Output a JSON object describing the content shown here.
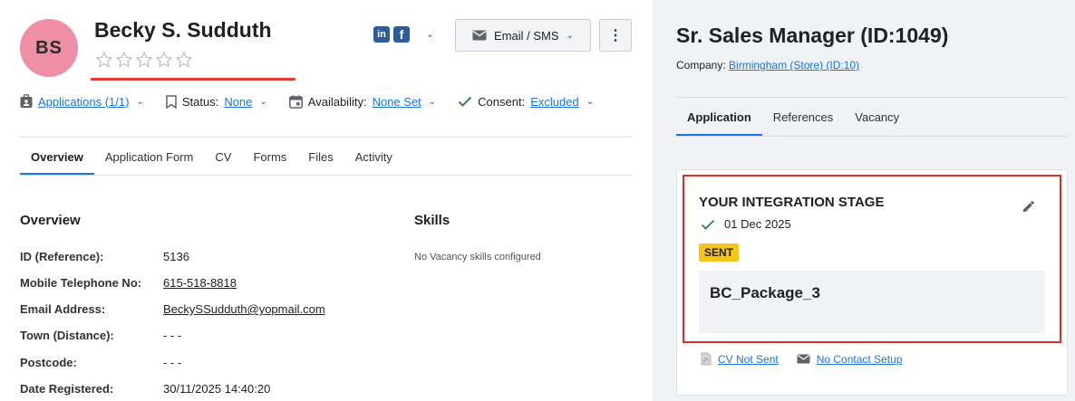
{
  "candidate": {
    "initials": "BS",
    "name": "Becky S. Sudduth",
    "rating_stars": 5,
    "rating_value": 0,
    "avatar_color": "#ee8fa6"
  },
  "actions": {
    "email_sms_label": "Email / SMS",
    "social": [
      "linkedin-icon",
      "facebook-icon"
    ]
  },
  "meta": {
    "applications_label": "Applications (1/1)",
    "status_label": "Status:",
    "status_value": "None",
    "availability_label": "Availability:",
    "availability_value": "None Set",
    "consent_label": "Consent:",
    "consent_value": "Excluded"
  },
  "tabs": [
    "Overview",
    "Application Form",
    "CV",
    "Forms",
    "Files",
    "Activity"
  ],
  "overview": {
    "title": "Overview",
    "fields": [
      {
        "label": "ID (Reference):",
        "value": "5136",
        "link": false
      },
      {
        "label": "Mobile Telephone No:",
        "value": "615-518-8818",
        "link": true
      },
      {
        "label": "Email Address:",
        "value": "BeckySSudduth@yopmail.com",
        "link": true
      },
      {
        "label": "Town (Distance):",
        "value": "- - -",
        "link": false
      },
      {
        "label": "Postcode:",
        "value": "- - -",
        "link": false
      },
      {
        "label": "Date Registered:",
        "value": "30/11/2025 14:40:20",
        "link": false
      }
    ]
  },
  "skills": {
    "title": "Skills",
    "empty_text": "No Vacancy skills configured"
  },
  "vacancy": {
    "title": "Sr. Sales Manager (ID:1049)",
    "company_label": "Company:",
    "company_value": "Birmingham (Store) (ID:10)",
    "tabs": [
      "Application",
      "References",
      "Vacancy"
    ]
  },
  "stage": {
    "title": "YOUR INTEGRATION STAGE",
    "date": "01 Dec 2025",
    "badge": "SENT",
    "badge_color": "#f5c518",
    "package": "BC_Package_3"
  },
  "footer_links": {
    "cv_label": "CV Not Sent",
    "contact_label": "No Contact Setup"
  },
  "colors": {
    "accent": "#1a73e8",
    "highlight_outline": "#d93025",
    "success": "#1e8e3e"
  }
}
